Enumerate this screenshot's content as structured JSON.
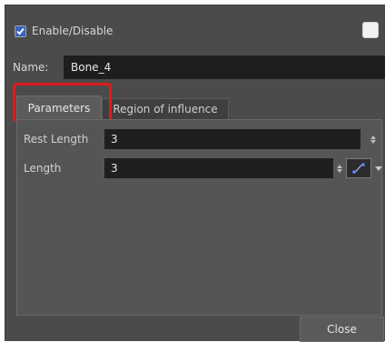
{
  "enable": {
    "label": "Enable/Disable",
    "checked": true
  },
  "color_swatch": {
    "color": "#f2f2f2"
  },
  "name": {
    "label": "Name:",
    "value": "Bone_4"
  },
  "tabs": [
    {
      "label": "Parameters",
      "active": true
    },
    {
      "label": "Region of influence",
      "active": false
    }
  ],
  "fields": [
    {
      "label": "Rest Length",
      "value": "3"
    },
    {
      "label": "Length",
      "value": "3"
    }
  ],
  "buttons": {
    "close_label": "Close"
  },
  "colors": {
    "highlight": "#e01b1b",
    "panel_bg": "#4b4b4b"
  }
}
